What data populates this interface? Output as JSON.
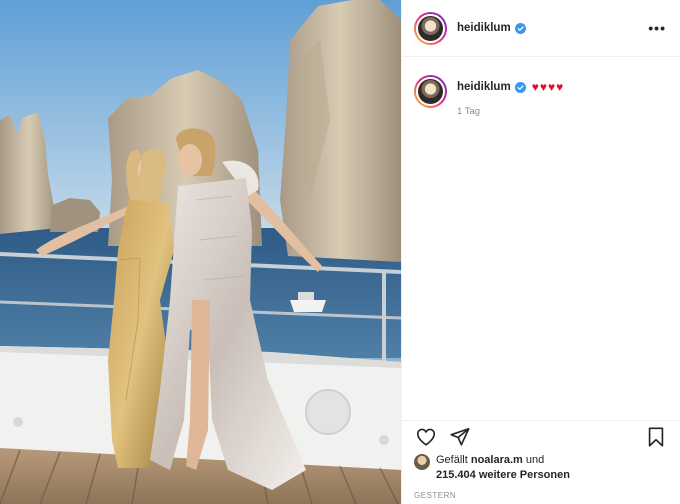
{
  "header": {
    "username": "heidiklum",
    "more_icon": "more-horizontal-icon",
    "more_label": "•••"
  },
  "caption": {
    "username": "heidiklum",
    "text": "♥♥♥♥",
    "time": "1 Tag"
  },
  "actions": {
    "like_icon": "heart-outline-icon",
    "share_icon": "paper-plane-icon",
    "save_icon": "bookmark-icon"
  },
  "likes": {
    "prefix": "Gefällt",
    "user": "noalara.m",
    "middle": "und",
    "count": "215.404 weitere Personen"
  },
  "date": "GESTERN",
  "colors": {
    "verified": "#3897f0",
    "heart": "#e0102b",
    "border": "#efefef",
    "muted": "#8e8e8e"
  }
}
